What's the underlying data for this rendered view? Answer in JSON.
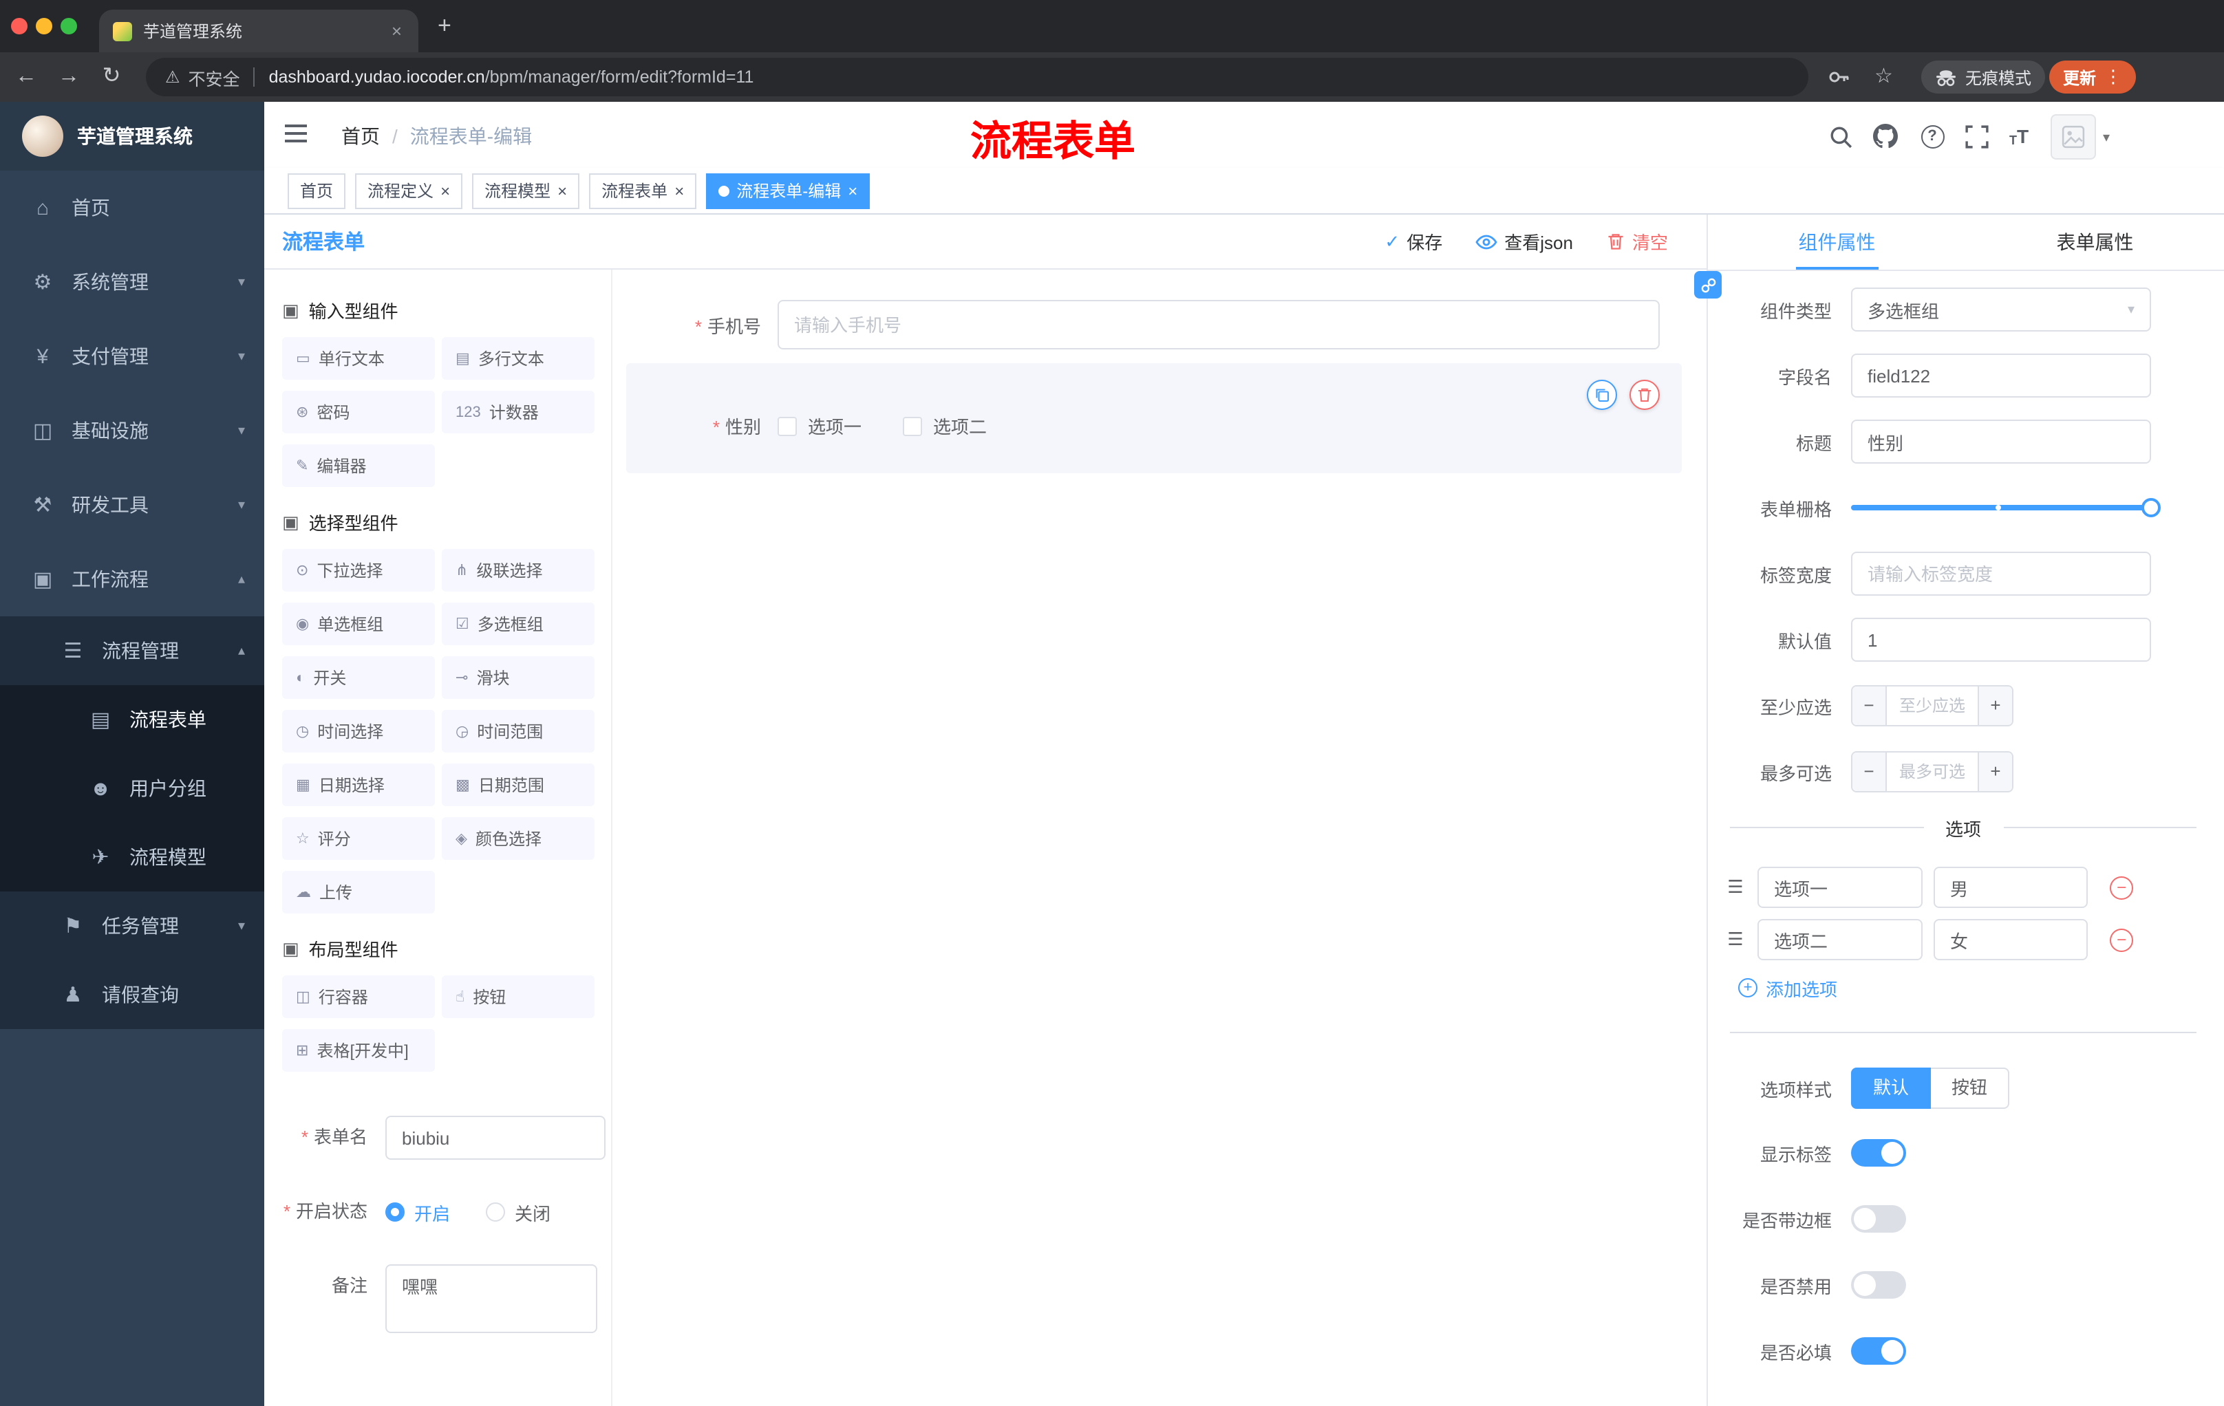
{
  "browser": {
    "tab_title": "芋道管理系统",
    "security_label": "不安全",
    "url_domain": "dashboard.yudao.iocoder.cn",
    "url_path": "/bpm/manager/form/edit?formId=11",
    "incognito_label": "无痕模式",
    "update_label": "更新"
  },
  "annotation": {
    "text": "流程表单",
    "color": "#ff0000"
  },
  "sidebar": {
    "logo_title": "芋道管理系统",
    "items": [
      {
        "label": "首页",
        "icon": "⌂",
        "level": 0,
        "chevron": ""
      },
      {
        "label": "系统管理",
        "icon": "⚙",
        "level": 0,
        "chevron": "▾"
      },
      {
        "label": "支付管理",
        "icon": "¥",
        "level": 0,
        "chevron": "▾"
      },
      {
        "label": "基础设施",
        "icon": "◫",
        "level": 0,
        "chevron": "▾"
      },
      {
        "label": "研发工具",
        "icon": "⚒",
        "level": 0,
        "chevron": "▾"
      },
      {
        "label": "工作流程",
        "icon": "▣",
        "level": 0,
        "chevron": "▴"
      },
      {
        "label": "流程管理",
        "icon": "☰",
        "level": 1,
        "chevron": "▴"
      },
      {
        "label": "流程表单",
        "icon": "▤",
        "level": 2,
        "chevron": "",
        "active": true
      },
      {
        "label": "用户分组",
        "icon": "☻",
        "level": 2,
        "chevron": ""
      },
      {
        "label": "流程模型",
        "icon": "✈",
        "level": 2,
        "chevron": ""
      },
      {
        "label": "任务管理",
        "icon": "⚑",
        "level": 1,
        "chevron": "▾"
      },
      {
        "label": "请假查询",
        "icon": "♟",
        "level": 1,
        "chevron": ""
      }
    ]
  },
  "header": {
    "breadcrumb_home": "首页",
    "breadcrumb_sep": "/",
    "breadcrumb_current": "流程表单-编辑"
  },
  "tags": [
    {
      "label": "首页",
      "closable": false,
      "active": false
    },
    {
      "label": "流程定义",
      "closable": true,
      "active": false
    },
    {
      "label": "流程模型",
      "closable": true,
      "active": false
    },
    {
      "label": "流程表单",
      "closable": true,
      "active": false
    },
    {
      "label": "流程表单-编辑",
      "closable": true,
      "active": true
    }
  ],
  "designer": {
    "title": "流程表单",
    "toolbar": {
      "save": "保存",
      "view_json": "查看json",
      "clear": "清空"
    },
    "palette_sections": [
      {
        "title": "输入型组件",
        "icon": "▣",
        "items": [
          {
            "label": "单行文本",
            "icon": "▭"
          },
          {
            "label": "多行文本",
            "icon": "▤"
          },
          {
            "label": "密码",
            "icon": "⊛"
          },
          {
            "label": "计数器",
            "icon": "123"
          },
          {
            "label": "编辑器",
            "icon": "✎"
          }
        ]
      },
      {
        "title": "选择型组件",
        "icon": "▣",
        "items": [
          {
            "label": "下拉选择",
            "icon": "⊙"
          },
          {
            "label": "级联选择",
            "icon": "⋔"
          },
          {
            "label": "单选框组",
            "icon": "◉"
          },
          {
            "label": "多选框组",
            "icon": "☑"
          },
          {
            "label": "开关",
            "icon": "◐"
          },
          {
            "label": "滑块",
            "icon": "⊸"
          },
          {
            "label": "时间选择",
            "icon": "◷"
          },
          {
            "label": "时间范围",
            "icon": "◶"
          },
          {
            "label": "日期选择",
            "icon": "▦"
          },
          {
            "label": "日期范围",
            "icon": "▩"
          },
          {
            "label": "评分",
            "icon": "☆"
          },
          {
            "label": "颜色选择",
            "icon": "◈"
          },
          {
            "label": "上传",
            "icon": "☁"
          }
        ]
      },
      {
        "title": "布局型组件",
        "icon": "▣",
        "items": [
          {
            "label": "行容器",
            "icon": "◫"
          },
          {
            "label": "按钮",
            "icon": "☝"
          },
          {
            "label": "表格[开发中]",
            "icon": "⊞"
          }
        ]
      }
    ],
    "meta": {
      "name_label": "表单名",
      "name_value": "biubiu",
      "status_label": "开启状态",
      "status_on": "开启",
      "status_off": "关闭",
      "remark_label": "备注",
      "remark_value": "嘿嘿"
    },
    "canvas": {
      "phone_label": "手机号",
      "phone_placeholder": "请输入手机号",
      "gender_label": "性别",
      "gender_options": [
        {
          "label": "选项一"
        },
        {
          "label": "选项二"
        }
      ]
    }
  },
  "props": {
    "tab_component": "组件属性",
    "tab_form": "表单属性",
    "rows": {
      "type_label": "组件类型",
      "type_value": "多选框组",
      "field_label": "字段名",
      "field_value": "field122",
      "title_label": "标题",
      "title_value": "性别",
      "grid_label": "表单栅格",
      "width_label": "标签宽度",
      "width_placeholder": "请输入标签宽度",
      "default_label": "默认值",
      "default_value": "1",
      "min_label": "至少应选",
      "min_placeholder": "至少应选",
      "max_label": "最多可选",
      "max_placeholder": "最多可选"
    },
    "options": {
      "divider": "选项",
      "rows": [
        {
          "label": "选项一",
          "value": "男"
        },
        {
          "label": "选项二",
          "value": "女"
        }
      ],
      "add": "添加选项"
    },
    "style": {
      "label": "选项样式",
      "choices_default": "默认",
      "choices_button": "按钮"
    },
    "switches": [
      {
        "label": "显示标签",
        "on": true
      },
      {
        "label": "是否带边框",
        "on": false
      },
      {
        "label": "是否禁用",
        "on": false
      },
      {
        "label": "是否必填",
        "on": true
      }
    ],
    "accent_color": "#409eff",
    "danger_color": "#f56c6c"
  }
}
